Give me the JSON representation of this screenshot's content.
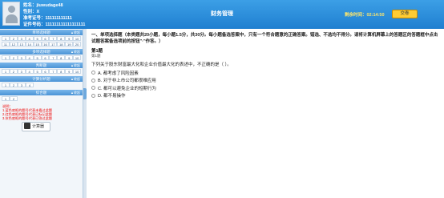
{
  "header": {
    "name_line": "姓名：jiuwudage48",
    "gender_line": "性别：X",
    "cert_line": "准考证号：111111111111",
    "id_line": "证件号码：111111111111111111",
    "title": "财务管理",
    "timer_line": "剩余时间：02:14:50",
    "submit_label": "交卷"
  },
  "sidebar": {
    "sections": [
      {
        "label": "单项选择题",
        "fold": "▲收起"
      },
      {
        "label": "多项选择题",
        "fold": "▲收起"
      },
      {
        "label": "判断题",
        "fold": "▲收起"
      },
      {
        "label": "计算分析题",
        "fold": "▲收起"
      },
      {
        "label": "综合题",
        "fold": "▲收起"
      }
    ],
    "notes": {
      "title": "说明：",
      "line1": "1.蓝色底框的题号代表未看过此题",
      "line2": "2.红色底框的题号代表已标记此题",
      "line3": "3.灰色底框的题号代表已答过此题"
    },
    "calc_label": "计算器"
  },
  "question": {
    "instructions": "一、单项选择题（本类题共20小题，每小题1.5分，共30分。每小题备选答案中，只有一个符合题意的正确答案。错选、不选均不得分。请将计算机屏幕上的答题区的答题框中点击试题答案备选项前的按钮\"·\"作答。）",
    "number": "第1题",
    "sub": "第1题",
    "text": "下列关于股东财富最大化和企业价值最大化的表述中，不正确的是（    ）。",
    "options": [
      {
        "label": "A. 都考虑了风险因素"
      },
      {
        "label": "B. 对于非上市公司都很难应用"
      },
      {
        "label": "C. 都可以避免企业的短期行为"
      },
      {
        "label": "D. 都不易操作"
      }
    ]
  }
}
